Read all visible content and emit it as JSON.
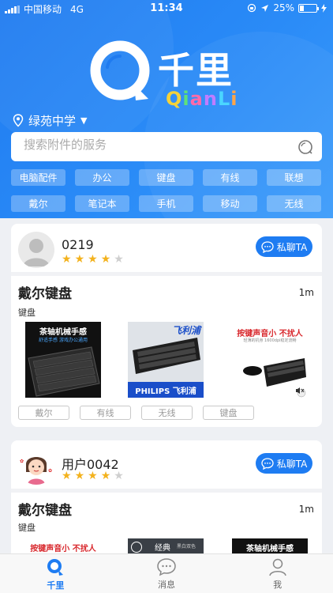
{
  "status_bar": {
    "carrier": "中国移动",
    "network": "4G",
    "time": "11:34",
    "battery_percent": "25%"
  },
  "logo": {
    "brand": "千里",
    "sub_letters": [
      "Q",
      "i",
      "a",
      "n",
      "L",
      "i"
    ],
    "sub_colors": [
      "#f4d23a",
      "#5fe17a",
      "#ff6aa9",
      "#c07cff",
      "#4ad6ff",
      "#ffa54a"
    ]
  },
  "location": {
    "label": "绿苑中学"
  },
  "search": {
    "placeholder": "搜索附件的服务"
  },
  "categories": [
    "电脑配件",
    "办公",
    "键盘",
    "有线",
    "联想",
    "戴尔",
    "笔记本",
    "手机",
    "移动",
    "无线"
  ],
  "posts": [
    {
      "user": "0219",
      "rating": 4,
      "rating_max": 5,
      "chat_label": "私聊TA",
      "title": "戴尔键盘",
      "time": "1m",
      "category": "键盘",
      "images": [
        {
          "caption_top": "茶轴机械手感",
          "caption_sub": "舒适手感 游戏办公通用"
        },
        {
          "caption_top": "飞利浦",
          "caption_bottom": "PHILIPS 飞利浦"
        },
        {
          "caption_top": "按键声音小  不扰人",
          "caption_sub": "轻薄的机身 1600dpi稳定流畅"
        }
      ],
      "tags": [
        "戴尔",
        "有线",
        "无线",
        "键盘"
      ]
    },
    {
      "user": "用户0042",
      "rating": 4,
      "rating_max": 5,
      "chat_label": "私聊TA",
      "title": "戴尔键盘",
      "time": "1m",
      "category": "键盘",
      "images": [
        {
          "caption_top": "按键声音小  不扰人"
        },
        {
          "caption_top": "经典",
          "caption_sub": "黑白双色"
        },
        {
          "caption_top": "茶轴机械手感"
        }
      ]
    }
  ],
  "tabbar": {
    "tabs": [
      {
        "label": "千里",
        "active": true
      },
      {
        "label": "消息",
        "active": false
      },
      {
        "label": "我",
        "active": false
      }
    ]
  },
  "colors": {
    "primary": "#1e7cf2",
    "star": "#f3b21d",
    "background": "#eef0f4"
  }
}
